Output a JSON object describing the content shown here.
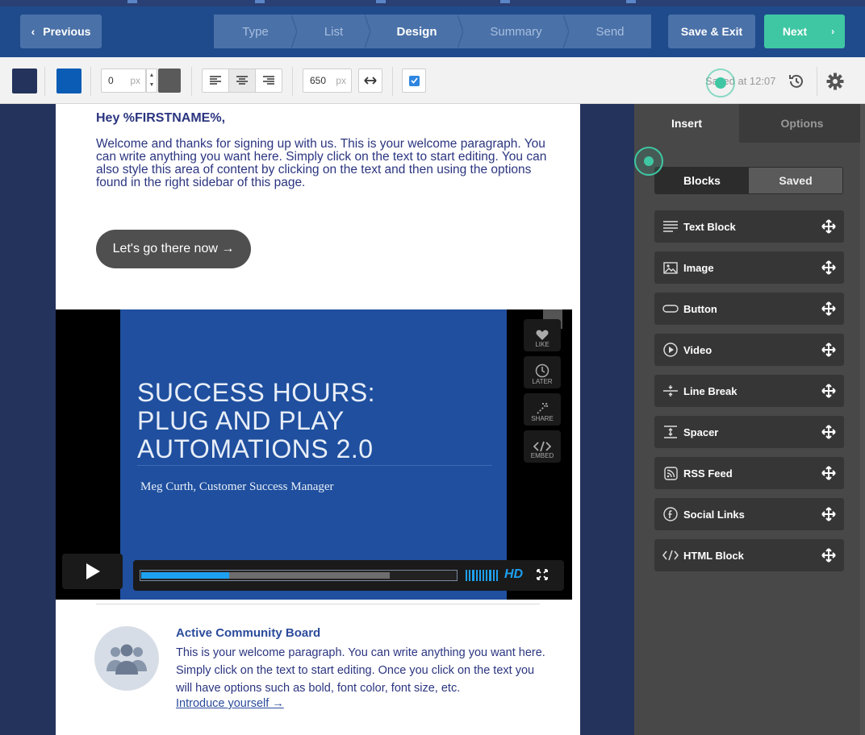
{
  "header": {
    "previous_label": "Previous",
    "previous_chevron": "‹",
    "steps": [
      {
        "label": "Type",
        "active": false
      },
      {
        "label": "List",
        "active": false
      },
      {
        "label": "Design",
        "active": true
      },
      {
        "label": "Summary",
        "active": false
      },
      {
        "label": "Send",
        "active": false
      }
    ],
    "save_exit_label": "Save & Exit",
    "next_label": "Next",
    "next_chevron": "›"
  },
  "toolbar": {
    "bg_color": "#24335c",
    "content_color": "#0b5cb5",
    "padding_value": "0",
    "padding_unit": "px",
    "width_value": "650",
    "width_unit": "px",
    "saved_text": "Saved at 12:07"
  },
  "email": {
    "greeting": "Hey %FIRSTNAME%,",
    "welcome": "Welcome and thanks for signing up with us. This is your welcome paragraph. You can write anything you want here. Simply click on the text to start editing. You can also style this area of content by clicking on the text and then using the options found in the right sidebar of this page.",
    "cta_label": "Let's go there now →",
    "video": {
      "title": "SUCCESS HOURS:\nPLUG AND PLAY\nAUTOMATIONS 2.0",
      "subtitle": "Meg Curth, Customer Success Manager",
      "side_buttons": [
        "LIKE",
        "LATER",
        "SHARE",
        "EMBED"
      ],
      "hd_label": "HD",
      "played_fraction": 0.28,
      "loaded_fraction": 0.79
    },
    "board": {
      "title": "Active Community Board",
      "text": "This is your welcome paragraph. You can write anything you want here. Simply click on the text to start editing. Once you click on the text you will have options such as bold, font color, font size, etc.",
      "link": "Introduce yourself →"
    }
  },
  "sidebar": {
    "tabs": [
      "Insert",
      "Options"
    ],
    "segments": [
      "Blocks",
      "Saved"
    ],
    "blocks": [
      {
        "label": "Text Block",
        "icon": "text-lines-icon"
      },
      {
        "label": "Image",
        "icon": "image-icon"
      },
      {
        "label": "Button",
        "icon": "button-shape-icon"
      },
      {
        "label": "Video",
        "icon": "play-circle-icon"
      },
      {
        "label": "Line Break",
        "icon": "line-break-icon"
      },
      {
        "label": "Spacer",
        "icon": "spacer-icon"
      },
      {
        "label": "RSS Feed",
        "icon": "rss-icon"
      },
      {
        "label": "Social Links",
        "icon": "facebook-icon"
      },
      {
        "label": "HTML Block",
        "icon": "code-icon"
      }
    ]
  },
  "colors": {
    "topbar": "#1f4b8c",
    "accent_green": "#3fc7a3",
    "text_blue": "#2b3580"
  }
}
